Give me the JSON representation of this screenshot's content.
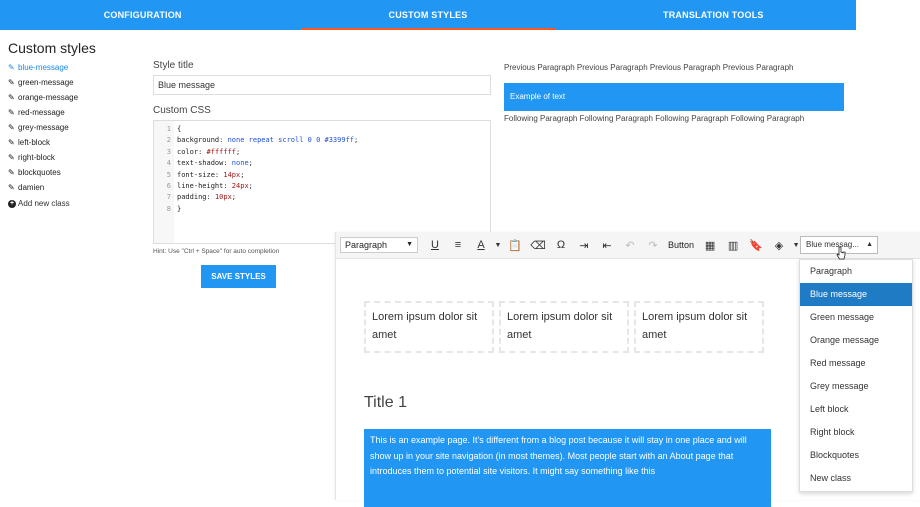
{
  "tabs": [
    {
      "label": "CONFIGURATION"
    },
    {
      "label": "CUSTOM STYLES"
    },
    {
      "label": "TRANSLATION TOOLS"
    }
  ],
  "sidebar": {
    "title": "Custom styles",
    "items": [
      {
        "label": "blue-message"
      },
      {
        "label": "green-message"
      },
      {
        "label": "orange-message"
      },
      {
        "label": "red-message"
      },
      {
        "label": "grey-message"
      },
      {
        "label": "left-block"
      },
      {
        "label": "right-block"
      },
      {
        "label": "blockquotes"
      },
      {
        "label": "damien"
      }
    ],
    "add_label": "Add new class"
  },
  "form": {
    "style_title_label": "Style title",
    "style_title_value": "Blue message",
    "custom_css_label": "Custom CSS",
    "css_lines": [
      {
        "num": "1",
        "text": "{"
      },
      {
        "num": "2",
        "prop": "background: ",
        "val": "none repeat scroll 0 0 #3399ff",
        "end": ";"
      },
      {
        "num": "3",
        "prop": "color: ",
        "val": "#ffffff",
        "end": ";"
      },
      {
        "num": "4",
        "prop": "text-shadow: ",
        "val": "none",
        "end": ";"
      },
      {
        "num": "5",
        "prop": "font-size: ",
        "val": "14px",
        "end": ";"
      },
      {
        "num": "6",
        "prop": "line-height: ",
        "val": "24px",
        "end": ";"
      },
      {
        "num": "7",
        "prop": "padding: ",
        "val": "10px",
        "end": ";"
      },
      {
        "num": "8",
        "text": "}"
      }
    ],
    "hint": "Hint: Use \"Ctrl + Space\" for auto completion",
    "save_label": "SAVE STYLES"
  },
  "preview": {
    "previous": "Previous Paragraph Previous Paragraph Previous Paragraph Previous Paragraph",
    "example": "Example of text",
    "following": "Following Paragraph Following Paragraph Following Paragraph Following Paragraph"
  },
  "editor": {
    "format_select": "Paragraph",
    "button_label": "Button",
    "style_select": "Blue messag...",
    "columns": [
      "Lorem ipsum dolor sit amet",
      "Lorem ipsum dolor sit amet",
      "Lorem ipsum dolor sit amet"
    ],
    "heading": "Title 1",
    "paragraph": "This is an example page. It's different from a blog post because it will stay in one place and will show up in your site navigation (in most themes). Most people start with an About page that introduces them to potential site visitors. It might say something like this"
  },
  "dropdown": {
    "items": [
      "Paragraph",
      "Blue message",
      "Green message",
      "Orange message",
      "Red message",
      "Grey message",
      "Left block",
      "Right block",
      "Blockquotes",
      "New class"
    ],
    "selected": "Blue message"
  },
  "colors": {
    "accent": "#2196f3",
    "tab_indicator": "#ff5722",
    "dropdown_selected": "#1e7bc4"
  }
}
